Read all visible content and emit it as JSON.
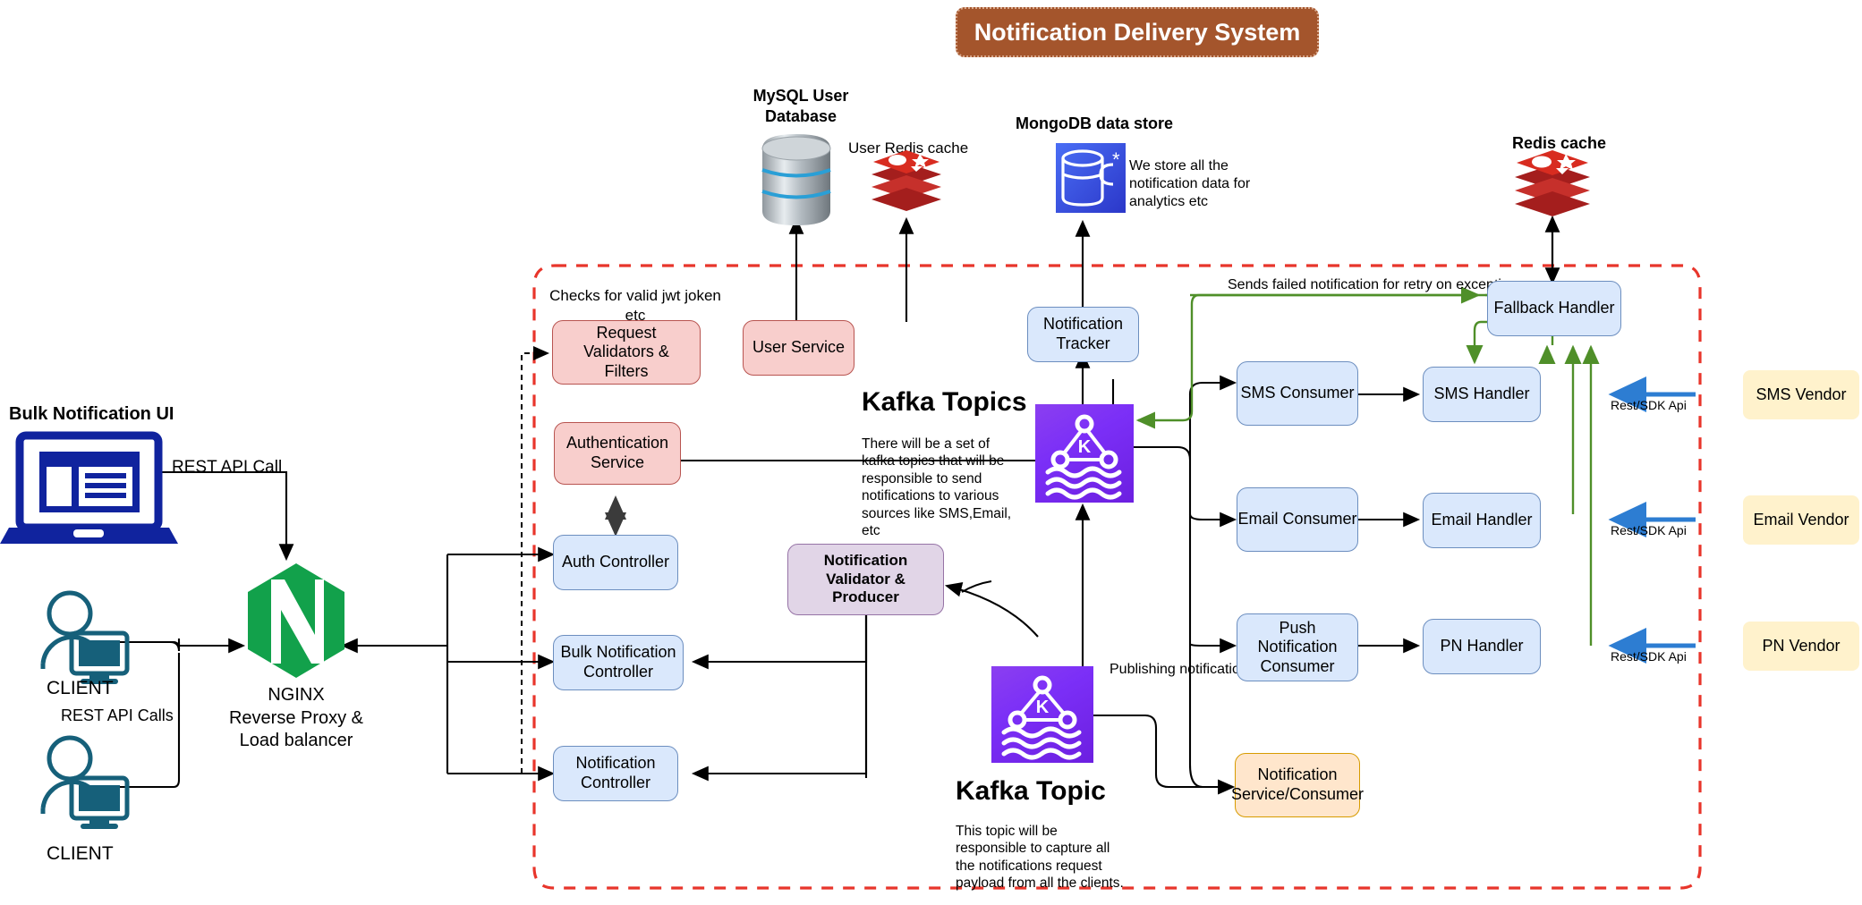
{
  "title": {
    "text": "Notification Delivery System",
    "bg": "#a4552c",
    "fg": "#ffffff"
  },
  "left": {
    "bulk_ui_label": "Bulk Notification UI",
    "rest_api_call": "REST API Call",
    "client_top": "CLIENT",
    "rest_api_calls": "REST API Calls",
    "client_bottom": "CLIENT",
    "nginx_name": "NGINX",
    "nginx_sub1": "Reverse Proxy &",
    "nginx_sub2": "Load balancer"
  },
  "datastores": {
    "mysql_label_line1": "MySQL User",
    "mysql_label_line2": "Database",
    "user_redis_label": "User Redis cache",
    "mongo_label": "MongoDB data store",
    "mongo_note": "We store all the notification data for analytics etc",
    "redis_label": "Redis cache"
  },
  "services": {
    "jwt_note_line1": "Checks for valid jwt joken",
    "jwt_note_line2": "etc",
    "request_validators": "Request Validators & Filters",
    "authentication_service": "Authentication Service",
    "user_service": "User Service",
    "auth_controller": "Auth Controller",
    "bulk_notification_controller": "Bulk Notification Controller",
    "notification_controller": "Notification Controller",
    "notification_validator": "Notification Validator & Producer",
    "notification_tracker": "Notification Tracker"
  },
  "kafka": {
    "topics_title": "Kafka Topics",
    "topics_desc": "There will be a set of kafka topics that will be responsible to send notifications to various sources like SMS,Email, etc",
    "topic_title": "Kafka Topic",
    "topic_desc": "This topic will be responsible to capture all the notifications request payload from all the clients.",
    "publishing_label": "Publishing notification",
    "glyph": "K"
  },
  "pipeline": {
    "fallback_handler": "Fallback Handler",
    "retry_label": "Sends failed notification for retry on exception",
    "rows": [
      {
        "consumer": "SMS Consumer",
        "handler": "SMS Handler",
        "api": "Rest/SDK Api",
        "vendor": "SMS Vendor"
      },
      {
        "consumer": "Email Consumer",
        "handler": "Email Handler",
        "api": "Rest/SDK Api",
        "vendor": "Email Vendor"
      },
      {
        "consumer": "Push Notification Consumer",
        "handler": "PN Handler",
        "api": "Rest/SDK Api",
        "vendor": "PN Vendor"
      }
    ],
    "notification_service_consumer": "Notification Service/Consumer"
  },
  "colors": {
    "boundary": "#e8352b",
    "retry_green": "#4f8f29",
    "vendor_blue": "#2d7dd2",
    "nginx_green": "#0f9d58",
    "client_teal": "#16607a",
    "ui_navy": "#10239e"
  }
}
